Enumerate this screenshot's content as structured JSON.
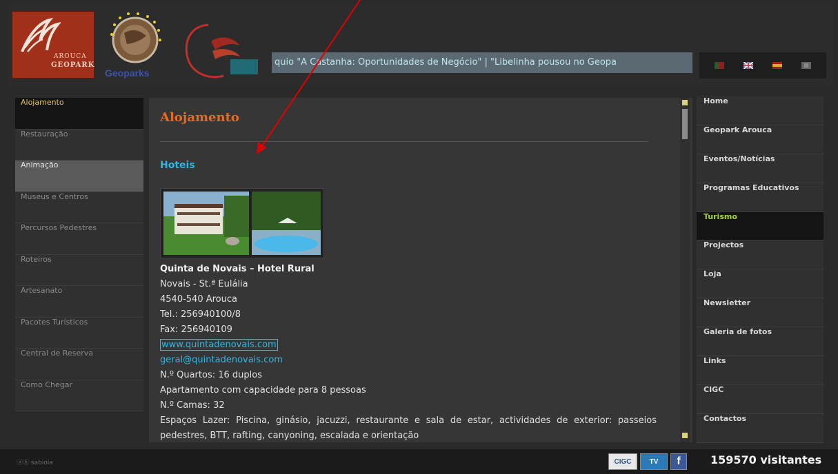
{
  "header": {
    "logo_arouca_line1": "AROUCA",
    "logo_arouca_line2": "GEOPARK",
    "logo_geoparks_text": "Geoparks",
    "ticker_text": "quio \"A Castanha: Oportunidades de Negócio\"   |  \"Libelinha pousou no Geopa"
  },
  "left_nav": [
    {
      "label": "Alojamento",
      "state": "active"
    },
    {
      "label": "Restauração",
      "state": ""
    },
    {
      "label": "Animação",
      "state": "hover"
    },
    {
      "label": "Museus e Centros",
      "state": ""
    },
    {
      "label": "Percursos Pedestres",
      "state": ""
    },
    {
      "label": "Roteiros",
      "state": ""
    },
    {
      "label": "Artesanato",
      "state": ""
    },
    {
      "label": "Pacotes Turísticos",
      "state": ""
    },
    {
      "label": "Central de Reserva",
      "state": ""
    },
    {
      "label": "Como Chegar",
      "state": ""
    }
  ],
  "content": {
    "title": "Alojamento",
    "subtitle": "Hoteis",
    "hotel": {
      "name": "Quinta de Novais – Hotel Rural",
      "address1": "Novais - St.ª Eulália",
      "address2": "4540-540 Arouca",
      "tel": "Tel.: 256940100/8",
      "fax": "Fax: 256940109",
      "website": "www.quintadenovais.com",
      "email": "geral@quintadenovais.com",
      "rooms": "N.º Quartos: 16 duplos",
      "apartment": "Apartamento com capacidade para 8 pessoas",
      "beds": "N.º Camas: 32",
      "leisure": "Espaços Lazer: Piscina, ginásio, jacuzzi, restaurante e sala de estar, actividades de exterior: passeios pedestres, BTT, rafting, canyoning, escalada e orientação"
    }
  },
  "right_nav": [
    {
      "label": "Home",
      "active": false
    },
    {
      "label": "Geopark Arouca",
      "active": false
    },
    {
      "label": "Eventos/Notícias",
      "active": false
    },
    {
      "label": "Programas Educativos",
      "active": false
    },
    {
      "label": "Turismo",
      "active": true
    },
    {
      "label": "Projectos",
      "active": false
    },
    {
      "label": "Loja",
      "active": false
    },
    {
      "label": "Newsletter",
      "active": false
    },
    {
      "label": "Galeria de fotos",
      "active": false
    },
    {
      "label": "Links",
      "active": false
    },
    {
      "label": "CIGC",
      "active": false
    },
    {
      "label": "Contactos",
      "active": false
    }
  ],
  "footer": {
    "credit": "ⓐⓑ sabiola",
    "icon_cigc": "CIGC",
    "icon_tv": "TV",
    "icon_facebook": "f",
    "visitors": "159570 visitantes"
  },
  "colors": {
    "accent_orange": "#e86a22",
    "link_blue": "#2fb7e3",
    "turismo_green": "#a8d43a",
    "annotation_arrow": "#e00000"
  }
}
